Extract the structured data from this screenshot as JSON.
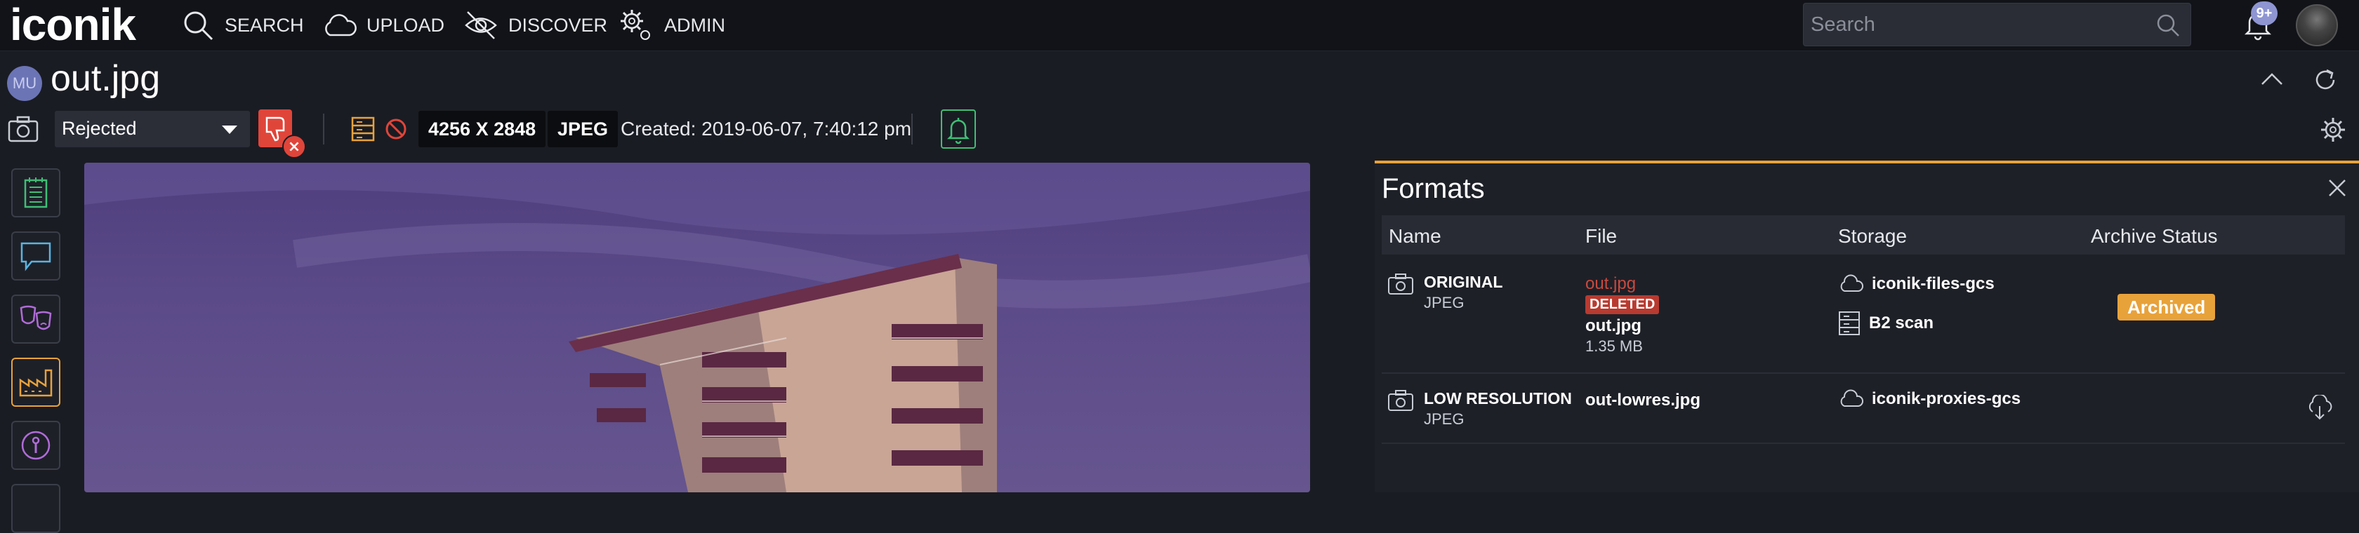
{
  "app": {
    "logo": "iconik"
  },
  "nav": {
    "search": "SEARCH",
    "upload": "UPLOAD",
    "discover": "DISCOVER",
    "admin": "ADMIN"
  },
  "search": {
    "placeholder": "Search"
  },
  "notifications": {
    "badge": "9+"
  },
  "asset": {
    "owner_initials": "MU",
    "title": "out.jpg",
    "status": "Rejected",
    "dimensions": "4256 X 2848",
    "format": "JPEG",
    "created": "Created: 2019-06-07, 7:40:12 pm"
  },
  "formats_panel": {
    "title": "Formats",
    "columns": [
      "Name",
      "File",
      "Storage",
      "Archive Status"
    ],
    "rows": [
      {
        "name": "ORIGINAL",
        "type": "JPEG",
        "deleted_file": "out.jpg",
        "deleted_label": "DELETED",
        "file": "out.jpg",
        "size": "1.35 MB",
        "storage": [
          "iconik-files-gcs",
          "B2 scan"
        ],
        "archive_status": "Archived"
      },
      {
        "name": "LOW RESOLUTION",
        "type": "JPEG",
        "file": "out-lowres.jpg",
        "storage": [
          "iconik-proxies-gcs"
        ]
      }
    ]
  },
  "colors": {
    "accent": "#e8a23a",
    "rejected": "#e0453a",
    "deleted": "#b83a30",
    "notify": "#3fbf76"
  }
}
